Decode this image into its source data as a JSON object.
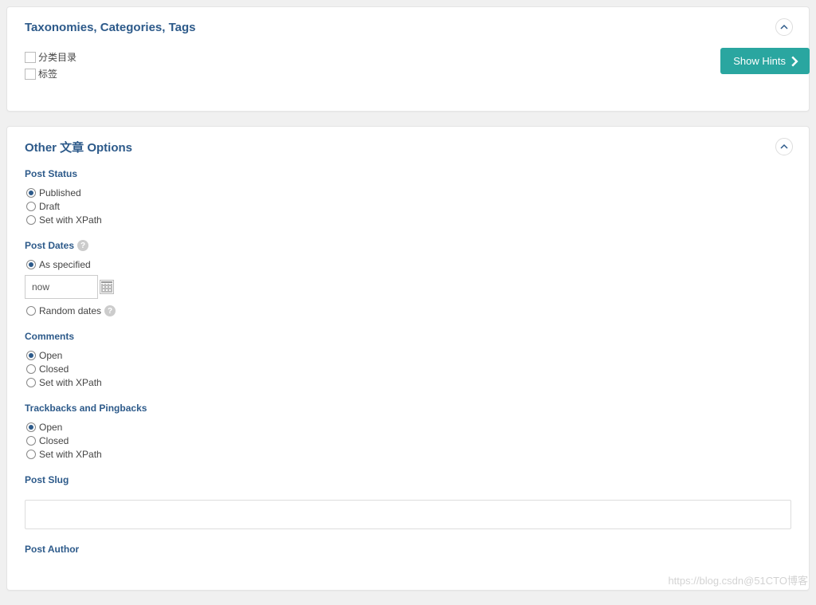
{
  "panel1": {
    "title": "Taxonomies, Categories, Tags",
    "checkboxes": [
      {
        "label": "分类目录"
      },
      {
        "label": "标签"
      }
    ]
  },
  "showHints": "Show Hints",
  "panel2": {
    "title": "Other 文章 Options",
    "postStatus": {
      "label": "Post Status",
      "options": [
        {
          "label": "Published",
          "checked": true
        },
        {
          "label": "Draft",
          "checked": false
        },
        {
          "label": "Set with XPath",
          "checked": false
        }
      ]
    },
    "postDates": {
      "label": "Post Dates",
      "options": {
        "asSpecified": {
          "label": "As specified",
          "checked": true
        },
        "random": {
          "label": "Random dates",
          "checked": false
        }
      },
      "inputValue": "now"
    },
    "comments": {
      "label": "Comments",
      "options": [
        {
          "label": "Open",
          "checked": true
        },
        {
          "label": "Closed",
          "checked": false
        },
        {
          "label": "Set with XPath",
          "checked": false
        }
      ]
    },
    "trackbacks": {
      "label": "Trackbacks and Pingbacks",
      "options": [
        {
          "label": "Open",
          "checked": true
        },
        {
          "label": "Closed",
          "checked": false
        },
        {
          "label": "Set with XPath",
          "checked": false
        }
      ]
    },
    "postSlug": {
      "label": "Post Slug",
      "value": ""
    },
    "postAuthor": {
      "label": "Post Author"
    }
  },
  "watermark": "https://blog.csdn@51CTO博客"
}
